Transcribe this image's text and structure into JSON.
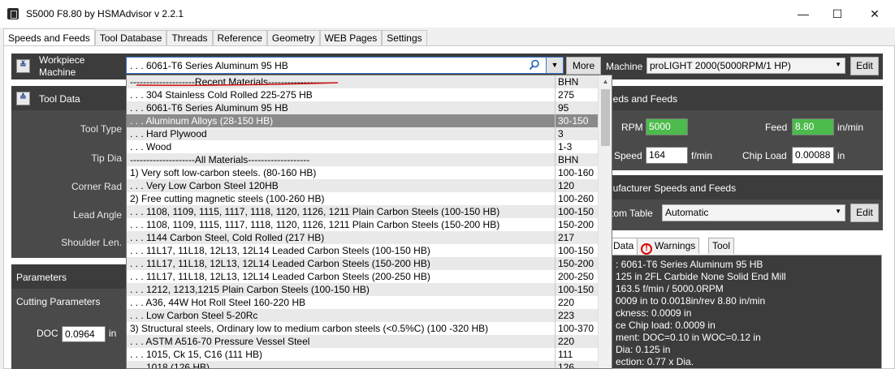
{
  "window": {
    "title": "S5000 F8.80 by HSMAdvisor v 2.2.1",
    "minimize": "—",
    "maximize": "☐",
    "close": "✕"
  },
  "tabs": [
    "Speeds and Feeds",
    "Tool Database",
    "Threads",
    "Reference",
    "Geometry",
    "WEB Pages",
    "Settings"
  ],
  "workpiece": {
    "label_line1": "Workpiece",
    "label_line2": "Machine",
    "collapse": "≚",
    "value": ". . . 6061-T6 Series Aluminum 95 HB",
    "more_label": "More"
  },
  "machine": {
    "label": "Machine",
    "value": "proLIGHT 2000(5000RPM/1 HP)",
    "edit_label": "Edit"
  },
  "tool_data": {
    "title": "Tool Data",
    "collapse": "≙",
    "labels": [
      "Tool Type",
      "Tip Dia",
      "Corner Rad",
      "Lead Angle",
      "Shoulder Len."
    ]
  },
  "parameters": {
    "title": "Parameters",
    "cutting": "Cutting Parameters",
    "doc_label": "DOC",
    "doc_value": "0.0964",
    "doc_unit": "in"
  },
  "speeds_feeds": {
    "title": "eeds and Feeds",
    "rpm_label": "RPM",
    "rpm_value": "5000",
    "feed_label": "Feed",
    "feed_value": "8.80",
    "feed_unit": "in/min",
    "speed_label": "Speed",
    "speed_value": "164",
    "speed_unit": "f/min",
    "chipload_label": "Chip Load",
    "chipload_value": "0.00088",
    "chipload_unit": "in"
  },
  "manufacturer": {
    "title": "nufacturer Speeds and Feeds",
    "table_label": "tom Table",
    "table_value": "Automatic",
    "edit_label": "Edit"
  },
  "lower_tabs": {
    "data": "Data",
    "warnings": "Warnings",
    "tool": "Tool",
    "warn_glyph": "!"
  },
  "info_lines": [
    ": 6061-T6 Series Aluminum 95 HB",
    "125 in 2FL Carbide None Solid End Mill",
    "163.5 f/min / 5000.0RPM",
    "0009 in to 0.0018in/rev 8.80 in/min",
    "ckness: 0.0009 in",
    "ce Chip load: 0.0009 in",
    "ment: DOC=0.10 in WOC=0.12 in",
    "Dia: 0.125 in",
    "ection: 0.77 x Dia."
  ],
  "dropdown": {
    "rows": [
      {
        "name": "--------------------Recent Materials---------------------",
        "bhn": "BHN",
        "style": "alt"
      },
      {
        "name": ". . . 304 Stainless Cold Rolled 225-275 HB",
        "bhn": "275",
        "style": ""
      },
      {
        "name": ". . . 6061-T6 Series Aluminum 95 HB",
        "bhn": "95",
        "style": "alt"
      },
      {
        "name": ". . . Aluminum Alloys (28-150 HB)",
        "bhn": "30-150",
        "style": "sel"
      },
      {
        "name": ". . . Hard Plywood",
        "bhn": "3",
        "style": "alt"
      },
      {
        "name": ". . . Wood",
        "bhn": "1-3",
        "style": ""
      },
      {
        "name": "--------------------All Materials-------------------",
        "bhn": "BHN",
        "style": "alt"
      },
      {
        "name": "1) Very soft low-carbon steels. (80-160 HB)",
        "bhn": "100-160",
        "style": ""
      },
      {
        "name": ". . . Very Low Carbon Steel 120HB",
        "bhn": "120",
        "style": "alt"
      },
      {
        "name": "2) Free cutting magnetic steels (100-260 HB)",
        "bhn": "100-260",
        "style": ""
      },
      {
        "name": ". . . 1108, 1109, 1115, 1117, 1118, 1120, 1126, 1211 Plain Carbon Steels (100-150 HB)",
        "bhn": "100-150",
        "style": "alt"
      },
      {
        "name": ". . . 1108, 1109, 1115, 1117, 1118, 1120, 1126, 1211 Plain Carbon Steels (150-200 HB)",
        "bhn": "150-200",
        "style": ""
      },
      {
        "name": ". . . 1144 Carbon Steel, Cold Rolled  (217 HB)",
        "bhn": "217",
        "style": "alt"
      },
      {
        "name": ". . . 11L17, 11L18, 12L13, 12L14 Leaded Carbon Steels (100-150 HB)",
        "bhn": "100-150",
        "style": ""
      },
      {
        "name": ". . . 11L17, 11L18, 12L13, 12L14 Leaded Carbon Steels (150-200 HB)",
        "bhn": "150-200",
        "style": "alt"
      },
      {
        "name": ". . . 11L17, 11L18, 12L13, 12L14 Leaded Carbon Steels (200-250 HB)",
        "bhn": "200-250",
        "style": ""
      },
      {
        "name": ". . . 1212, 1213,1215 Plain Carbon Steels (100-150 HB)",
        "bhn": "100-150",
        "style": "alt"
      },
      {
        "name": ". . . A36, 44W Hot Roll Steel 160-220 HB",
        "bhn": "220",
        "style": ""
      },
      {
        "name": ". . . Low Carbon Steel 5-20Rc",
        "bhn": "223",
        "style": "alt"
      },
      {
        "name": "3) Structural steels, Ordinary low to medium carbon steels (<0.5%C) (100 -320 HB)",
        "bhn": "100-370",
        "style": ""
      },
      {
        "name": ". . . ASTM A516-70 Pressure Vessel Steel",
        "bhn": "220",
        "style": "alt"
      },
      {
        "name": ". . . 1015, Ck 15, C16  (111 HB)",
        "bhn": "111",
        "style": ""
      },
      {
        "name": ". . . 1018 (126 HB)",
        "bhn": "126",
        "style": "alt"
      }
    ]
  }
}
